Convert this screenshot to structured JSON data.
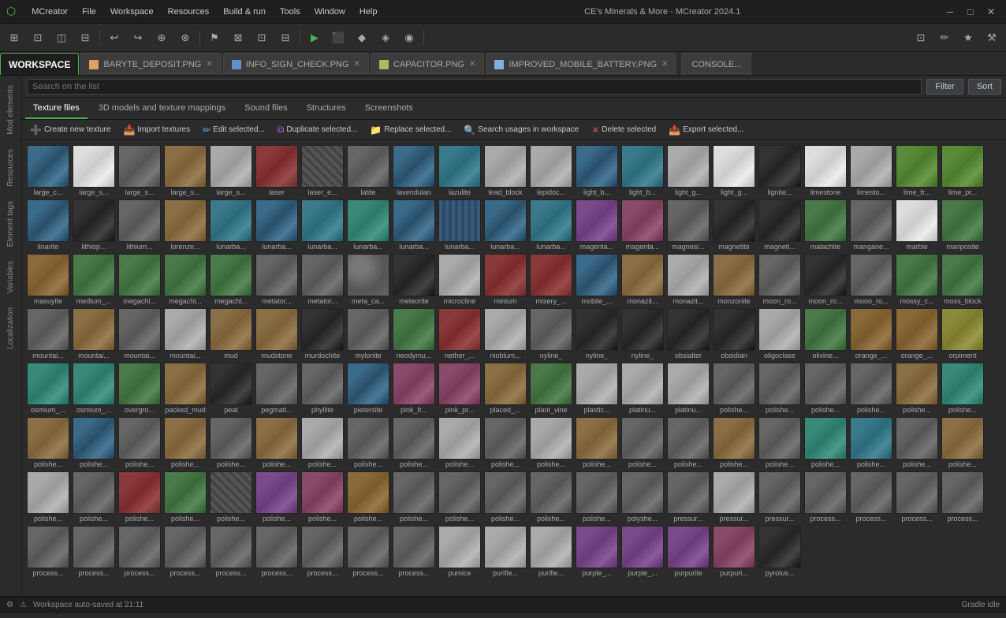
{
  "titlebar": {
    "app_icon": "⬡",
    "menu_items": [
      "MCreator",
      "File",
      "Workspace",
      "Resources",
      "Build & run",
      "Tools",
      "Window",
      "Help"
    ],
    "center_title": "CE's Minerals & More - MCreator 2024.1",
    "win_buttons": [
      "─",
      "□",
      "✕"
    ]
  },
  "tabs": [
    {
      "id": "workspace",
      "label": "WORKSPACE",
      "closeable": false
    },
    {
      "id": "baryte",
      "label": "BARYTE_DEPOSIT.PNG",
      "closeable": true
    },
    {
      "id": "info_sign",
      "label": "INFO_SIGN_CHECK.PNG",
      "closeable": true
    },
    {
      "id": "capacitor",
      "label": "CAPACITOR.PNG",
      "closeable": true
    },
    {
      "id": "improved",
      "label": "IMPROVED_MOBILE_BATTERY.PNG",
      "closeable": true
    }
  ],
  "console_tab": "CONSOLE...",
  "search": {
    "placeholder": "Search on the list",
    "filter_label": "Filter",
    "sort_label": "Sort"
  },
  "subtabs": [
    {
      "id": "texture_files",
      "label": "Texture files",
      "active": true
    },
    {
      "id": "3d_models",
      "label": "3D models and texture mappings"
    },
    {
      "id": "sound_files",
      "label": "Sound files"
    },
    {
      "id": "structures",
      "label": "Structures"
    },
    {
      "id": "screenshots",
      "label": "Screenshots"
    }
  ],
  "action_buttons": [
    {
      "id": "create_new",
      "icon": "➕",
      "label": "Create new texture"
    },
    {
      "id": "import",
      "icon": "📥",
      "label": "Import textures"
    },
    {
      "id": "edit",
      "icon": "✏️",
      "label": "Edit selected..."
    },
    {
      "id": "duplicate",
      "icon": "📋",
      "label": "Duplicate selected..."
    },
    {
      "id": "replace",
      "icon": "📁",
      "label": "Replace selected..."
    },
    {
      "id": "search_usages",
      "icon": "🔍",
      "label": "Search usages in workspace"
    },
    {
      "id": "delete",
      "icon": "❌",
      "label": "Delete selected"
    },
    {
      "id": "export",
      "icon": "📤",
      "label": "Export selected..."
    }
  ],
  "sidebar_items": [
    "Mod elements",
    "Resources",
    "Element tags",
    "Variables",
    "Localization"
  ],
  "textures": [
    {
      "label": "large_c...",
      "color": "t-blue"
    },
    {
      "label": "large_s...",
      "color": "t-white"
    },
    {
      "label": "large_s...",
      "color": "t-gray"
    },
    {
      "label": "large_s...",
      "color": "t-brown"
    },
    {
      "label": "large_s...",
      "color": "t-light"
    },
    {
      "label": "laser",
      "color": "t-red"
    },
    {
      "label": "laser_e...",
      "color": "t-mixed"
    },
    {
      "label": "latite",
      "color": "t-gray"
    },
    {
      "label": "lavendulan",
      "color": "t-blue"
    },
    {
      "label": "lazulite",
      "color": "t-cyan"
    },
    {
      "label": "lead_block",
      "color": "t-light"
    },
    {
      "label": "lepidoc...",
      "color": "t-light"
    },
    {
      "label": "light_b...",
      "color": "t-blue"
    },
    {
      "label": "light_b...",
      "color": "t-cyan"
    },
    {
      "label": "light_g...",
      "color": "t-light"
    },
    {
      "label": "light_g...",
      "color": "t-white"
    },
    {
      "label": "lignite...",
      "color": "t-dark"
    },
    {
      "label": "limestone",
      "color": "t-white"
    },
    {
      "label": "limesto...",
      "color": "t-light"
    },
    {
      "label": "lime_fr...",
      "color": "t-lime"
    },
    {
      "label": "lime_pr...",
      "color": "t-lime"
    },
    {
      "label": "linarite",
      "color": "t-blue"
    },
    {
      "label": "lithiop...",
      "color": "t-dark"
    },
    {
      "label": "lithium...",
      "color": "t-gray"
    },
    {
      "label": "lorenze...",
      "color": "t-brown"
    },
    {
      "label": "lunarba...",
      "color": "t-cyan"
    },
    {
      "label": "lunarba...",
      "color": "t-blue"
    },
    {
      "label": "lunarba...",
      "color": "t-cyan"
    },
    {
      "label": "lunarba...",
      "color": "t-teal"
    },
    {
      "label": "lunarba...",
      "color": "t-blue"
    },
    {
      "label": "lunarba...",
      "color": "t-pattern1"
    },
    {
      "label": "lunarba...",
      "color": "t-blue"
    },
    {
      "label": "lunarba...",
      "color": "t-cyan"
    },
    {
      "label": "magenta...",
      "color": "t-purple"
    },
    {
      "label": "magenta...",
      "color": "t-pink"
    },
    {
      "label": "magnesi...",
      "color": "t-gray"
    },
    {
      "label": "magnetite",
      "color": "t-dark"
    },
    {
      "label": "magneti...",
      "color": "t-dark"
    },
    {
      "label": "malachite",
      "color": "t-green"
    },
    {
      "label": "mangane...",
      "color": "t-gray"
    },
    {
      "label": "marble",
      "color": "t-white"
    },
    {
      "label": "mariposite",
      "color": "t-green"
    },
    {
      "label": "masuyite",
      "color": "t-orange"
    },
    {
      "label": "medium_...",
      "color": "t-green"
    },
    {
      "label": "megachl...",
      "color": "t-green"
    },
    {
      "label": "megachl...",
      "color": "t-green"
    },
    {
      "label": "megachl...",
      "color": "t-green"
    },
    {
      "label": "metator...",
      "color": "t-gray"
    },
    {
      "label": "metator...",
      "color": "t-gray"
    },
    {
      "label": "meta_ca...",
      "color": "t-stone"
    },
    {
      "label": "meteorite",
      "color": "t-dark"
    },
    {
      "label": "microcline",
      "color": "t-light"
    },
    {
      "label": "minium",
      "color": "t-red"
    },
    {
      "label": "misery_...",
      "color": "t-red"
    },
    {
      "label": "mobile_...",
      "color": "t-blue"
    },
    {
      "label": "monazit...",
      "color": "t-brown"
    },
    {
      "label": "monazit...",
      "color": "t-light"
    },
    {
      "label": "monzonite",
      "color": "t-brown"
    },
    {
      "label": "moon_ro...",
      "color": "t-gray"
    },
    {
      "label": "moon_ro...",
      "color": "t-dark"
    },
    {
      "label": "moon_ro...",
      "color": "t-gray"
    },
    {
      "label": "mossy_c...",
      "color": "t-green"
    },
    {
      "label": "moss_block",
      "color": "t-green"
    },
    {
      "label": "mountai...",
      "color": "t-gray"
    },
    {
      "label": "mountai...",
      "color": "t-brown"
    },
    {
      "label": "mountai...",
      "color": "t-gray"
    },
    {
      "label": "mountai...",
      "color": "t-light"
    },
    {
      "label": "mud",
      "color": "t-brown"
    },
    {
      "label": "mudstone",
      "color": "t-brown"
    },
    {
      "label": "murdochite",
      "color": "t-dark"
    },
    {
      "label": "mylonite",
      "color": "t-gray"
    },
    {
      "label": "neodymu...",
      "color": "t-green"
    },
    {
      "label": "nether_...",
      "color": "t-red"
    },
    {
      "label": "nioblum...",
      "color": "t-light"
    },
    {
      "label": "nyline_",
      "color": "t-gray"
    },
    {
      "label": "nyline_",
      "color": "t-dark"
    },
    {
      "label": "nyline_",
      "color": "t-dark"
    },
    {
      "label": "obsialter",
      "color": "t-dark"
    },
    {
      "label": "obsidian",
      "color": "t-dark"
    },
    {
      "label": "oligoclase",
      "color": "t-light"
    },
    {
      "label": "olivine...",
      "color": "t-green"
    },
    {
      "label": "orange_...",
      "color": "t-orange"
    },
    {
      "label": "orange_...",
      "color": "t-orange"
    },
    {
      "label": "orpiment",
      "color": "t-yellow"
    },
    {
      "label": "osmium_...",
      "color": "t-teal"
    },
    {
      "label": "osmium_...",
      "color": "t-teal"
    },
    {
      "label": "overgro...",
      "color": "t-green"
    },
    {
      "label": "packed_mud",
      "color": "t-brown"
    },
    {
      "label": "peat",
      "color": "t-dark"
    },
    {
      "label": "pegmati...",
      "color": "t-gray"
    },
    {
      "label": "phyllite",
      "color": "t-gray"
    },
    {
      "label": "pietersite",
      "color": "t-blue"
    },
    {
      "label": "pink_fr...",
      "color": "t-pink"
    },
    {
      "label": "pink_pr...",
      "color": "t-pink"
    },
    {
      "label": "placed_...",
      "color": "t-brown"
    },
    {
      "label": "plant_vine",
      "color": "t-green"
    },
    {
      "label": "plastic...",
      "color": "t-light"
    },
    {
      "label": "platinu...",
      "color": "t-light"
    },
    {
      "label": "platinu...",
      "color": "t-light"
    },
    {
      "label": "polishe...",
      "color": "t-gray"
    },
    {
      "label": "polishe...",
      "color": "t-gray"
    },
    {
      "label": "polishe...",
      "color": "t-gray"
    },
    {
      "label": "polishe...",
      "color": "t-gray"
    },
    {
      "label": "polishe...",
      "color": "t-brown"
    },
    {
      "label": "polishe...",
      "color": "t-teal"
    },
    {
      "label": "polishe...",
      "color": "t-brown"
    },
    {
      "label": "polishe...",
      "color": "t-blue"
    },
    {
      "label": "polishe...",
      "color": "t-gray"
    },
    {
      "label": "polishe...",
      "color": "t-brown"
    },
    {
      "label": "polishe...",
      "color": "t-gray"
    },
    {
      "label": "polishe...",
      "color": "t-brown"
    },
    {
      "label": "polishe...",
      "color": "t-light"
    },
    {
      "label": "polishe...",
      "color": "t-gray"
    },
    {
      "label": "polishe...",
      "color": "t-gray"
    },
    {
      "label": "polishe...",
      "color": "t-light"
    },
    {
      "label": "polishe...",
      "color": "t-gray"
    },
    {
      "label": "polishe...",
      "color": "t-light"
    },
    {
      "label": "polishe...",
      "color": "t-brown"
    },
    {
      "label": "polishe...",
      "color": "t-gray"
    },
    {
      "label": "polishe...",
      "color": "t-gray"
    },
    {
      "label": "polishe...",
      "color": "t-brown"
    },
    {
      "label": "polishe...",
      "color": "t-gray"
    },
    {
      "label": "polishe...",
      "color": "t-teal"
    },
    {
      "label": "polishe...",
      "color": "t-cyan"
    },
    {
      "label": "polishe...",
      "color": "t-gray"
    },
    {
      "label": "polishe...",
      "color": "t-brown"
    },
    {
      "label": "polishe...",
      "color": "t-light"
    },
    {
      "label": "polishe...",
      "color": "t-gray"
    },
    {
      "label": "polishe...",
      "color": "t-red"
    },
    {
      "label": "polishe...",
      "color": "t-green"
    },
    {
      "label": "polishe...",
      "color": "t-mixed"
    },
    {
      "label": "polishe...",
      "color": "t-purple"
    },
    {
      "label": "polishe...",
      "color": "t-pink"
    },
    {
      "label": "polishe...",
      "color": "t-orange"
    },
    {
      "label": "polishe...",
      "color": "t-gray"
    },
    {
      "label": "polishe...",
      "color": "t-gray"
    },
    {
      "label": "polishe...",
      "color": "t-gray"
    },
    {
      "label": "polishe...",
      "color": "t-gray"
    },
    {
      "label": "polishe...",
      "color": "t-gray"
    },
    {
      "label": "polyshe...",
      "color": "t-gray"
    },
    {
      "label": "pressur...",
      "color": "t-gray"
    },
    {
      "label": "pressur...",
      "color": "t-light"
    },
    {
      "label": "pressur...",
      "color": "t-gray"
    },
    {
      "label": "process...",
      "color": "t-gray"
    },
    {
      "label": "process...",
      "color": "t-gray"
    },
    {
      "label": "process...",
      "color": "t-gray"
    },
    {
      "label": "process...",
      "color": "t-gray"
    },
    {
      "label": "process...",
      "color": "t-gray"
    },
    {
      "label": "process...",
      "color": "t-gray"
    },
    {
      "label": "process...",
      "color": "t-gray"
    },
    {
      "label": "process...",
      "color": "t-gray"
    },
    {
      "label": "process...",
      "color": "t-gray"
    },
    {
      "label": "process...",
      "color": "t-gray"
    },
    {
      "label": "process...",
      "color": "t-gray"
    },
    {
      "label": "process...",
      "color": "t-gray"
    },
    {
      "label": "process...",
      "color": "t-gray"
    },
    {
      "label": "pumice",
      "color": "t-light"
    },
    {
      "label": "purifie...",
      "color": "t-light"
    },
    {
      "label": "purifie...",
      "color": "t-light"
    },
    {
      "label": "purple_...",
      "color": "t-purple"
    },
    {
      "label": "purple_...",
      "color": "t-purple"
    },
    {
      "label": "purpurite",
      "color": "t-purple"
    },
    {
      "label": "purpuri...",
      "color": "t-pink"
    },
    {
      "label": "pyrolus...",
      "color": "t-dark"
    }
  ],
  "statusbar": {
    "icons": [
      "⚙",
      "⚠"
    ],
    "message": "Workspace auto-saved at 21:11",
    "status": "Gradle idle"
  }
}
